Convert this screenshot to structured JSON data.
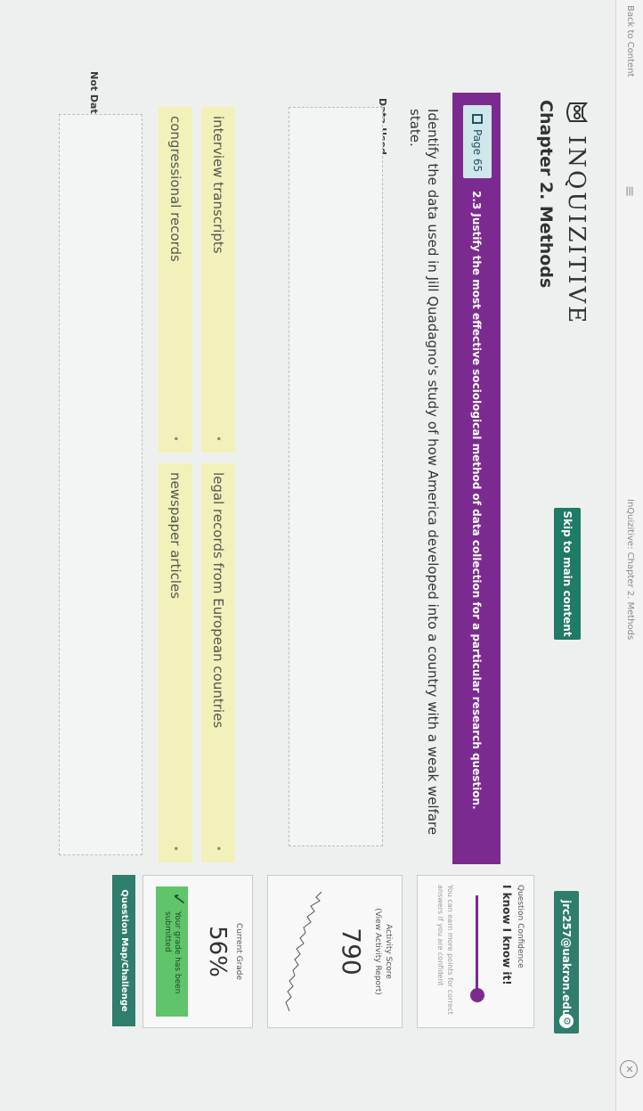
{
  "browser": {
    "back_label": "Back to Content",
    "menu_glyph": "≡",
    "tab_title": "InQuizitive: Chapter 2. Methods",
    "close_glyph": "✕"
  },
  "header": {
    "logo_text": "INQUIZITIVE",
    "chapter": "Chapter 2. Methods",
    "skip_label": "Skip to main content",
    "user": "jrc257@uakron.edu",
    "gear_glyph": "⚙"
  },
  "objective": {
    "page_label": "Page 65",
    "text": "2.3 Justify the most effective sociological method of data collection for a particular research question."
  },
  "question": {
    "prompt": "Identify the data used in Jill Quadagno's study of how America developed into a country with a weak welfare state."
  },
  "zones": {
    "used_label": "Data Used",
    "not_used_label": "Not Data Used"
  },
  "chips": [
    {
      "label": "interview transcripts",
      "marker": "•"
    },
    {
      "label": "legal records from European countries",
      "marker": "•"
    },
    {
      "label": "congressional records",
      "marker": "•"
    },
    {
      "label": "newspaper articles",
      "marker": "•"
    }
  ],
  "sidebar": {
    "confidence_label": "Question Confidence",
    "confidence_value": "I know I know it!",
    "confidence_level": 0.95,
    "confidence_hint": "You can earn more points for correct answers if you are confident",
    "activity_label": "Activity Score",
    "activity_sub": "(View Activity Report)",
    "activity_score": "790",
    "grade_label": "Current Grade",
    "grade_value": "56%",
    "submitted_text": "Your grade has been submitted",
    "check_glyph": "✓",
    "map_button": "Question Map/Challenge"
  },
  "colors": {
    "accent_purple": "#7b2b8f",
    "accent_green": "#1f7a66",
    "chip_yellow": "#f1f1b9",
    "success_green": "#5fc46a"
  }
}
